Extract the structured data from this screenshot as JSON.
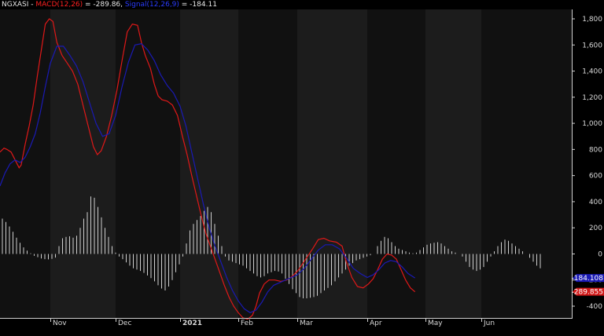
{
  "title_bar": {
    "symbol": "NGXASI",
    "sep1": " - ",
    "macd_label": "MACD(12,26)",
    "macd_value_text": " = -289.86, ",
    "signal_label": "Signal(12,26,9)",
    "signal_value_text": " = -184.11"
  },
  "colors": {
    "macd": "#e01818",
    "signal": "#1a1ab4",
    "histogram": "#d0d0d0",
    "band_dark": "#111111",
    "band_light": "#1c1c1c",
    "axis_text": "#d8d8d8"
  },
  "chart_data": {
    "type": "line",
    "x_labels": [
      "Nov",
      "Dec",
      "2021",
      "Feb",
      "Mar",
      "Apr",
      "May",
      "Jun"
    ],
    "y_ticks": [
      1800,
      1600,
      1400,
      1200,
      1000,
      800,
      600,
      400,
      200,
      0,
      -200,
      -400
    ],
    "ylim": [
      -500,
      1950
    ],
    "series": [
      {
        "name": "MACD(12,26)",
        "color": "#e01818",
        "points": [
          [
            0,
            780
          ],
          [
            0.08,
            810
          ],
          [
            0.14,
            800
          ],
          [
            0.22,
            780
          ],
          [
            0.3,
            720
          ],
          [
            0.38,
            660
          ],
          [
            0.42,
            680
          ],
          [
            0.5,
            840
          ],
          [
            0.58,
            980
          ],
          [
            0.66,
            1140
          ],
          [
            0.74,
            1360
          ],
          [
            0.82,
            1560
          ],
          [
            0.9,
            1760
          ],
          [
            0.98,
            1800
          ],
          [
            1.04,
            1780
          ],
          [
            1.1,
            1620
          ],
          [
            1.18,
            1520
          ],
          [
            1.26,
            1460
          ],
          [
            1.34,
            1400
          ],
          [
            1.42,
            1300
          ],
          [
            1.5,
            1140
          ],
          [
            1.58,
            980
          ],
          [
            1.66,
            820
          ],
          [
            1.72,
            760
          ],
          [
            1.78,
            790
          ],
          [
            1.86,
            900
          ],
          [
            1.94,
            1060
          ],
          [
            2.02,
            1250
          ],
          [
            2.1,
            1480
          ],
          [
            2.18,
            1700
          ],
          [
            2.26,
            1760
          ],
          [
            2.34,
            1750
          ],
          [
            2.4,
            1620
          ],
          [
            2.46,
            1520
          ],
          [
            2.54,
            1420
          ],
          [
            2.6,
            1300
          ],
          [
            2.66,
            1210
          ],
          [
            2.72,
            1180
          ],
          [
            2.8,
            1170
          ],
          [
            2.88,
            1140
          ],
          [
            2.96,
            1060
          ],
          [
            3.04,
            900
          ],
          [
            3.12,
            760
          ],
          [
            3.2,
            600
          ],
          [
            3.28,
            450
          ],
          [
            3.36,
            300
          ],
          [
            3.44,
            160
          ],
          [
            3.52,
            60
          ],
          [
            3.6,
            -40
          ],
          [
            3.68,
            -140
          ],
          [
            3.76,
            -240
          ],
          [
            3.84,
            -330
          ],
          [
            3.92,
            -400
          ],
          [
            4.0,
            -450
          ],
          [
            4.08,
            -490
          ],
          [
            4.16,
            -500
          ],
          [
            4.24,
            -470
          ],
          [
            4.3,
            -400
          ],
          [
            4.36,
            -300
          ],
          [
            4.44,
            -230
          ],
          [
            4.52,
            -200
          ],
          [
            4.62,
            -200
          ],
          [
            4.72,
            -210
          ],
          [
            4.82,
            -200
          ],
          [
            4.92,
            -170
          ],
          [
            5.02,
            -120
          ],
          [
            5.12,
            -40
          ],
          [
            5.22,
            40
          ],
          [
            5.3,
            110
          ],
          [
            5.38,
            120
          ],
          [
            5.46,
            100
          ],
          [
            5.56,
            90
          ],
          [
            5.64,
            60
          ],
          [
            5.7,
            -60
          ],
          [
            5.78,
            -180
          ],
          [
            5.86,
            -250
          ],
          [
            5.94,
            -260
          ],
          [
            6.02,
            -230
          ],
          [
            6.1,
            -190
          ],
          [
            6.18,
            -120
          ],
          [
            6.26,
            -40
          ],
          [
            6.34,
            0
          ],
          [
            6.42,
            -10
          ],
          [
            6.5,
            -40
          ],
          [
            6.58,
            -120
          ],
          [
            6.66,
            -200
          ],
          [
            6.74,
            -260
          ],
          [
            6.82,
            -290
          ]
        ]
      },
      {
        "name": "Signal(12,26,9)",
        "color": "#1a1ab4",
        "points": [
          [
            0,
            520
          ],
          [
            0.1,
            620
          ],
          [
            0.2,
            690
          ],
          [
            0.3,
            720
          ],
          [
            0.4,
            700
          ],
          [
            0.5,
            740
          ],
          [
            0.6,
            820
          ],
          [
            0.7,
            920
          ],
          [
            0.8,
            1080
          ],
          [
            0.9,
            1280
          ],
          [
            1.0,
            1460
          ],
          [
            1.1,
            1590
          ],
          [
            1.2,
            1590
          ],
          [
            1.3,
            1520
          ],
          [
            1.4,
            1440
          ],
          [
            1.5,
            1320
          ],
          [
            1.6,
            1160
          ],
          [
            1.7,
            1000
          ],
          [
            1.8,
            900
          ],
          [
            1.9,
            920
          ],
          [
            2.0,
            1060
          ],
          [
            2.1,
            1280
          ],
          [
            2.2,
            1470
          ],
          [
            2.3,
            1600
          ],
          [
            2.4,
            1610
          ],
          [
            2.5,
            1560
          ],
          [
            2.6,
            1480
          ],
          [
            2.7,
            1370
          ],
          [
            2.8,
            1290
          ],
          [
            2.9,
            1230
          ],
          [
            3.0,
            1130
          ],
          [
            3.1,
            980
          ],
          [
            3.2,
            780
          ],
          [
            3.3,
            580
          ],
          [
            3.4,
            380
          ],
          [
            3.5,
            200
          ],
          [
            3.6,
            60
          ],
          [
            3.7,
            -60
          ],
          [
            3.8,
            -180
          ],
          [
            3.9,
            -280
          ],
          [
            4.0,
            -360
          ],
          [
            4.1,
            -420
          ],
          [
            4.2,
            -450
          ],
          [
            4.3,
            -430
          ],
          [
            4.4,
            -370
          ],
          [
            4.5,
            -290
          ],
          [
            4.6,
            -240
          ],
          [
            4.7,
            -220
          ],
          [
            4.8,
            -200
          ],
          [
            4.9,
            -180
          ],
          [
            5.0,
            -160
          ],
          [
            5.1,
            -110
          ],
          [
            5.2,
            -40
          ],
          [
            5.3,
            30
          ],
          [
            5.4,
            70
          ],
          [
            5.5,
            70
          ],
          [
            5.6,
            40
          ],
          [
            5.7,
            -30
          ],
          [
            5.8,
            -110
          ],
          [
            5.9,
            -150
          ],
          [
            6.0,
            -180
          ],
          [
            6.1,
            -160
          ],
          [
            6.2,
            -120
          ],
          [
            6.3,
            -70
          ],
          [
            6.4,
            -50
          ],
          [
            6.5,
            -60
          ],
          [
            6.6,
            -100
          ],
          [
            6.7,
            -150
          ],
          [
            6.82,
            -184
          ]
        ]
      }
    ],
    "histogram": [
      270,
      245,
      210,
      170,
      125,
      85,
      50,
      25,
      5,
      -15,
      -25,
      -35,
      -40,
      -42,
      -38,
      -28,
      60,
      120,
      130,
      135,
      125,
      140,
      200,
      270,
      320,
      440,
      430,
      360,
      280,
      200,
      130,
      60,
      10,
      -20,
      -40,
      -65,
      -90,
      -110,
      -120,
      -130,
      -145,
      -165,
      -185,
      -210,
      -240,
      -265,
      -280,
      -250,
      -200,
      -140,
      -80,
      -20,
      80,
      180,
      230,
      260,
      290,
      330,
      360,
      320,
      230,
      140,
      60,
      -20,
      -50,
      -60,
      -70,
      -80,
      -90,
      -110,
      -130,
      -150,
      -170,
      -180,
      -170,
      -150,
      -140,
      -130,
      -135,
      -150,
      -190,
      -230,
      -270,
      -300,
      -330,
      -340,
      -340,
      -335,
      -330,
      -320,
      -300,
      -280,
      -260,
      -240,
      -210,
      -180,
      -150,
      -120,
      -90,
      -70,
      -50,
      -40,
      -30,
      -20,
      -10,
      0,
      60,
      100,
      130,
      120,
      90,
      60,
      40,
      30,
      20,
      10,
      5,
      10,
      30,
      50,
      70,
      80,
      85,
      90,
      80,
      60,
      40,
      20,
      10,
      0,
      -20,
      -60,
      -100,
      -120,
      -130,
      -120,
      -100,
      -60,
      -20,
      20,
      60,
      90,
      110,
      100,
      80,
      60,
      40,
      20,
      0,
      -30,
      -60,
      -90,
      -110
    ]
  },
  "labels": {
    "signal_last": "-184.108",
    "macd_last": "-289.855"
  }
}
